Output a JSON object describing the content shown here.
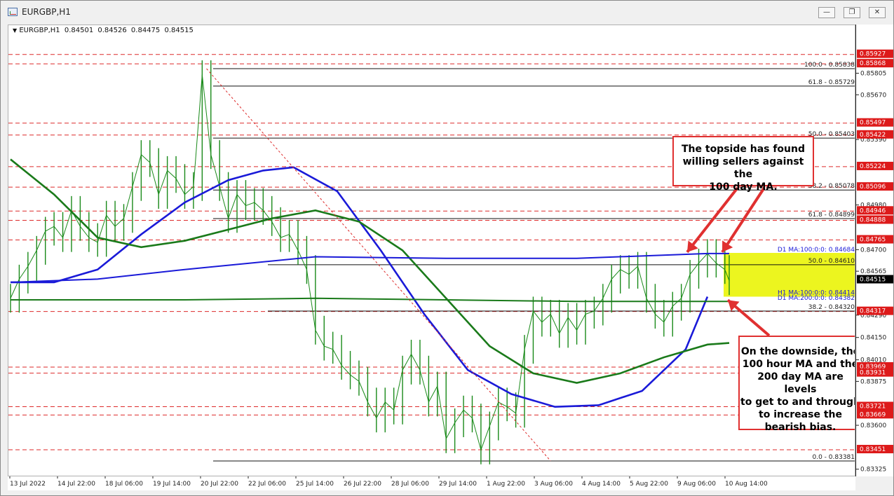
{
  "window": {
    "title": "EURGBP,H1",
    "buttons": {
      "minimize": "—",
      "restore": "❐",
      "close": "✕"
    },
    "icon": "chart-app-icon"
  },
  "header": {
    "symbol": "EURGBP,H1",
    "ohlc": [
      "0.84501",
      "0.84526",
      "0.84475",
      "0.84515"
    ]
  },
  "colors": {
    "ma_blue": "#1a1ad8",
    "ma_green": "#1a7a1a",
    "dashed_red": "#dd2a2a",
    "callout_border": "#e03030",
    "highlight": "#ecf51f",
    "price_label_bg": "#dd1a1a",
    "current_price_bg": "#000000"
  },
  "chart_data": {
    "type": "line",
    "symbol": "EURGBP",
    "timeframe": "H1",
    "ylim": [
      0.8328,
      0.8611
    ],
    "price_ticks": [
      "0.85805",
      "0.85670",
      "0.85390",
      "0.84980",
      "0.84700",
      "0.84565",
      "0.84290",
      "0.84150",
      "0.84010",
      "0.83875",
      "0.83600",
      "0.83325"
    ],
    "x_labels": [
      "13 Jul 2022",
      "14 Jul 22:00",
      "18 Jul 06:00",
      "19 Jul 14:00",
      "20 Jul 22:00",
      "22 Jul 06:00",
      "25 Jul 14:00",
      "26 Jul 22:00",
      "28 Jul 06:00",
      "29 Jul 14:00",
      "1 Aug 22:00",
      "3 Aug 06:00",
      "4 Aug 14:00",
      "5 Aug 22:00",
      "9 Aug 06:00",
      "10 Aug 14:00"
    ],
    "red_price_labels": [
      "0.85927",
      "0.85868",
      "0.85497",
      "0.85422",
      "0.85224",
      "0.85096",
      "0.84946",
      "0.84888",
      "0.84765",
      "0.84317",
      "0.83969",
      "0.83931",
      "0.83721",
      "0.83669",
      "0.83451"
    ],
    "current_price": "0.84515",
    "fibonacci_levels": [
      {
        "label": "100.0 - 0.85838",
        "price": 0.85838
      },
      {
        "label": "61.8 - 0.85729",
        "price": 0.85729
      },
      {
        "label": "50.0 - 0.85403",
        "price": 0.85403
      },
      {
        "label": "38.2 - 0.85078",
        "price": 0.85078
      },
      {
        "label": "61.8 - 0.84899",
        "price": 0.84899
      },
      {
        "label": "50.0 - 0.84610",
        "price": 0.8461
      },
      {
        "label": "38.2 - 0.84320",
        "price": 0.8432
      },
      {
        "label": "0.0 - 0.83381",
        "price": 0.83381
      }
    ],
    "ma_labels": [
      {
        "label": "D1 MA:100:0:0: 0.84684",
        "price": 0.84684
      },
      {
        "label": "H1 MA:100:0:0: 0.84414",
        "price": 0.84414
      },
      {
        "label": "D1 MA:200:0:0: 0.84382",
        "price": 0.84382
      },
      {
        "label": "H1 MA:200:0:0: 0.84116",
        "price": 0.84116
      }
    ],
    "highlight_zone": [
      0.8441,
      0.84684
    ],
    "series": [
      {
        "name": "H1 MA:100",
        "color": "#1a1ad8",
        "x": [
          0,
          10,
          20,
          30,
          40,
          50,
          58,
          65,
          75,
          85,
          95,
          105,
          115,
          125,
          135,
          145,
          155,
          160
        ],
        "values": [
          0.845,
          0.845,
          0.8458,
          0.848,
          0.85,
          0.8514,
          0.852,
          0.8522,
          0.8507,
          0.847,
          0.843,
          0.8395,
          0.838,
          0.8372,
          0.8373,
          0.8382,
          0.8408,
          0.8441
        ]
      },
      {
        "name": "H1 MA:200",
        "color": "#1a7a1a",
        "x": [
          0,
          10,
          20,
          30,
          40,
          50,
          60,
          70,
          80,
          90,
          100,
          110,
          120,
          130,
          140,
          150,
          160,
          165
        ],
        "values": [
          0.8527,
          0.8505,
          0.8478,
          0.8472,
          0.8476,
          0.8483,
          0.849,
          0.8495,
          0.8488,
          0.847,
          0.844,
          0.841,
          0.8393,
          0.8387,
          0.8393,
          0.8403,
          0.8411,
          0.8412
        ]
      },
      {
        "name": "D1 MA:100",
        "color": "#1a1ad8",
        "x": [
          0,
          20,
          40,
          55,
          70,
          100,
          130,
          160,
          165
        ],
        "values": [
          0.845,
          0.8452,
          0.8458,
          0.8462,
          0.8466,
          0.8465,
          0.8465,
          0.8468,
          0.8468
        ]
      },
      {
        "name": "D1 MA:200",
        "color": "#1a7a1a",
        "x": [
          0,
          40,
          70,
          100,
          130,
          165
        ],
        "values": [
          0.8439,
          0.8439,
          0.844,
          0.8439,
          0.8438,
          0.8438
        ]
      },
      {
        "name": "Price (close)",
        "color": "#1a8a1a",
        "x": [
          0,
          2,
          4,
          6,
          8,
          10,
          12,
          14,
          16,
          18,
          20,
          22,
          24,
          26,
          28,
          30,
          32,
          34,
          36,
          38,
          40,
          42,
          44,
          46,
          48,
          50,
          52,
          54,
          56,
          58,
          60,
          62,
          64,
          66,
          68,
          70,
          72,
          74,
          76,
          78,
          80,
          82,
          84,
          86,
          88,
          90,
          92,
          94,
          96,
          98,
          100,
          102,
          104,
          106,
          108,
          110,
          112,
          114,
          116,
          118,
          120,
          122,
          124,
          126,
          128,
          130,
          132,
          134,
          136,
          138,
          140,
          142,
          144,
          146,
          148,
          150,
          152,
          154,
          156,
          158,
          160,
          162,
          164,
          165
        ],
        "values": [
          0.844,
          0.8452,
          0.846,
          0.847,
          0.8482,
          0.8485,
          0.8478,
          0.8495,
          0.8485,
          0.8478,
          0.8475,
          0.8492,
          0.8485,
          0.849,
          0.851,
          0.853,
          0.8525,
          0.8505,
          0.852,
          0.8515,
          0.8505,
          0.851,
          0.858,
          0.853,
          0.851,
          0.849,
          0.8505,
          0.8498,
          0.85,
          0.8495,
          0.8488,
          0.8478,
          0.848,
          0.847,
          0.8458,
          0.842,
          0.841,
          0.8408,
          0.8398,
          0.8392,
          0.8388,
          0.8375,
          0.8365,
          0.8375,
          0.837,
          0.8395,
          0.8405,
          0.8395,
          0.8375,
          0.8385,
          0.8352,
          0.8362,
          0.837,
          0.8365,
          0.8345,
          0.836,
          0.8375,
          0.8372,
          0.8368,
          0.8408,
          0.8432,
          0.8425,
          0.843,
          0.8418,
          0.8428,
          0.842,
          0.843,
          0.8432,
          0.844,
          0.8452,
          0.8458,
          0.8455,
          0.846,
          0.844,
          0.843,
          0.8425,
          0.8435,
          0.844,
          0.8455,
          0.8462,
          0.8468,
          0.8462,
          0.8458,
          0.8451
        ]
      }
    ],
    "grid": false,
    "legend": "none",
    "title": "",
    "xlabel": "",
    "ylabel": ""
  },
  "callouts": [
    {
      "lines": [
        "The topside has found",
        "willing sellers against the",
        "100 day MA."
      ]
    },
    {
      "lines": [
        "On the downside, the",
        "100 hour MA and the",
        "200 day MA are levels",
        "to get to and through",
        "to increase the",
        "bearish bias."
      ]
    }
  ]
}
